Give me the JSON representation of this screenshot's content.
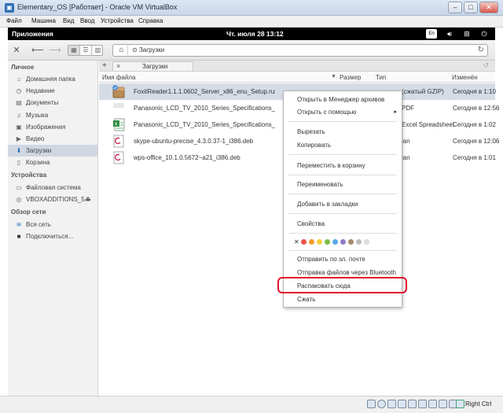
{
  "window": {
    "title": "Elementary_OS [Работает] - Oracle VM VirtualBox",
    "minimize": "–",
    "maximize": "□",
    "close": "✕"
  },
  "menubar": [
    "Файл",
    "Машина",
    "Вид",
    "Ввод",
    "Устройства",
    "Справка"
  ],
  "panel": {
    "apps": "Приложения",
    "clock": "Чт. июля 28   13:12",
    "lang": "En"
  },
  "toolbar": {
    "path_crumb": "Загрузки"
  },
  "sidebar": {
    "personal_header": "Личное",
    "personal": [
      {
        "label": "Домашняя папка",
        "icon": "home-icon"
      },
      {
        "label": "Недавние",
        "icon": "clock-icon"
      },
      {
        "label": "Документы",
        "icon": "document-icon"
      },
      {
        "label": "Музыка",
        "icon": "music-icon"
      },
      {
        "label": "Изображения",
        "icon": "image-icon"
      },
      {
        "label": "Видео",
        "icon": "video-icon"
      },
      {
        "label": "Загрузки",
        "icon": "download-icon"
      },
      {
        "label": "Корзина",
        "icon": "trash-icon"
      }
    ],
    "devices_header": "Устройства",
    "devices": [
      {
        "label": "Файловая система",
        "icon": "drive-icon"
      },
      {
        "label": "VBOXADDITIONS_5...",
        "icon": "disc-icon"
      }
    ],
    "network_header": "Обзор сети",
    "network": [
      {
        "label": "Вся сеть",
        "icon": "network-icon"
      },
      {
        "label": "Подключиться...",
        "icon": "monitor-icon"
      }
    ]
  },
  "tab": {
    "add": "+",
    "close": "×",
    "label": "Загрузки"
  },
  "columns": {
    "name": "Имя файла",
    "size": "Размер",
    "type": "Тип",
    "modified": "Изменён"
  },
  "files": [
    {
      "name": "FoxitReader1.1.1.0602_Server_x86_enu_Setup.run.tar.gz",
      "type": "(сжатый GZIP)",
      "modified": "Сегодня в 1:10",
      "icon": "archive-icon",
      "selected": true
    },
    {
      "name": "Panasonic_LCD_TV_2010_Series_Specifications_Compare_Tool.pdf",
      "type": "PDF",
      "modified": "Сегодня в 12:56",
      "icon": "pdf-icon"
    },
    {
      "name": "Panasonic_LCD_TV_2010_Series_Specifications_Compare_Tool.xls",
      "type": "Excel Spreadsheet",
      "modified": "Сегодня в 1:02",
      "icon": "spreadsheet-icon"
    },
    {
      "name": "skype-ubuntu-precise_4.3.0.37-1_i386.deb",
      "type": "ian",
      "modified": "Сегодня в 12:06",
      "icon": "debian-package-icon"
    },
    {
      "name": "wps-office_10.1.0.5672~a21_i386.deb",
      "type": "ian",
      "modified": "Сегодня в 1:01",
      "icon": "debian-package-icon"
    }
  ],
  "context_menu": {
    "open_archive": "Открыть в Менеджер архивов",
    "open_with": "Открыть с помощью",
    "cut": "Вырезать",
    "copy": "Копировать",
    "trash": "Переместить в корзину",
    "rename": "Переименовать",
    "bookmark": "Добавить в закладки",
    "properties": "Свойства",
    "send_mail": "Отправить по эл. почте",
    "send_bt": "Отправка файлов через Bluetooth",
    "extract_here": "Распаковать сюда",
    "compress": "Сжать",
    "tag_clear": "✕",
    "tag_colors": [
      "#e8524a",
      "#f39c2a",
      "#f4d03f",
      "#7dbd4a",
      "#5aa9e6",
      "#8e7cc3",
      "#a68b6e",
      "#bdbdbd",
      "#dddddd"
    ]
  },
  "status": {
    "host_key": "Right Ctrl"
  },
  "colors": {
    "highlight": "#e0102a",
    "selection": "#d5dce6",
    "panel": "#000000"
  }
}
